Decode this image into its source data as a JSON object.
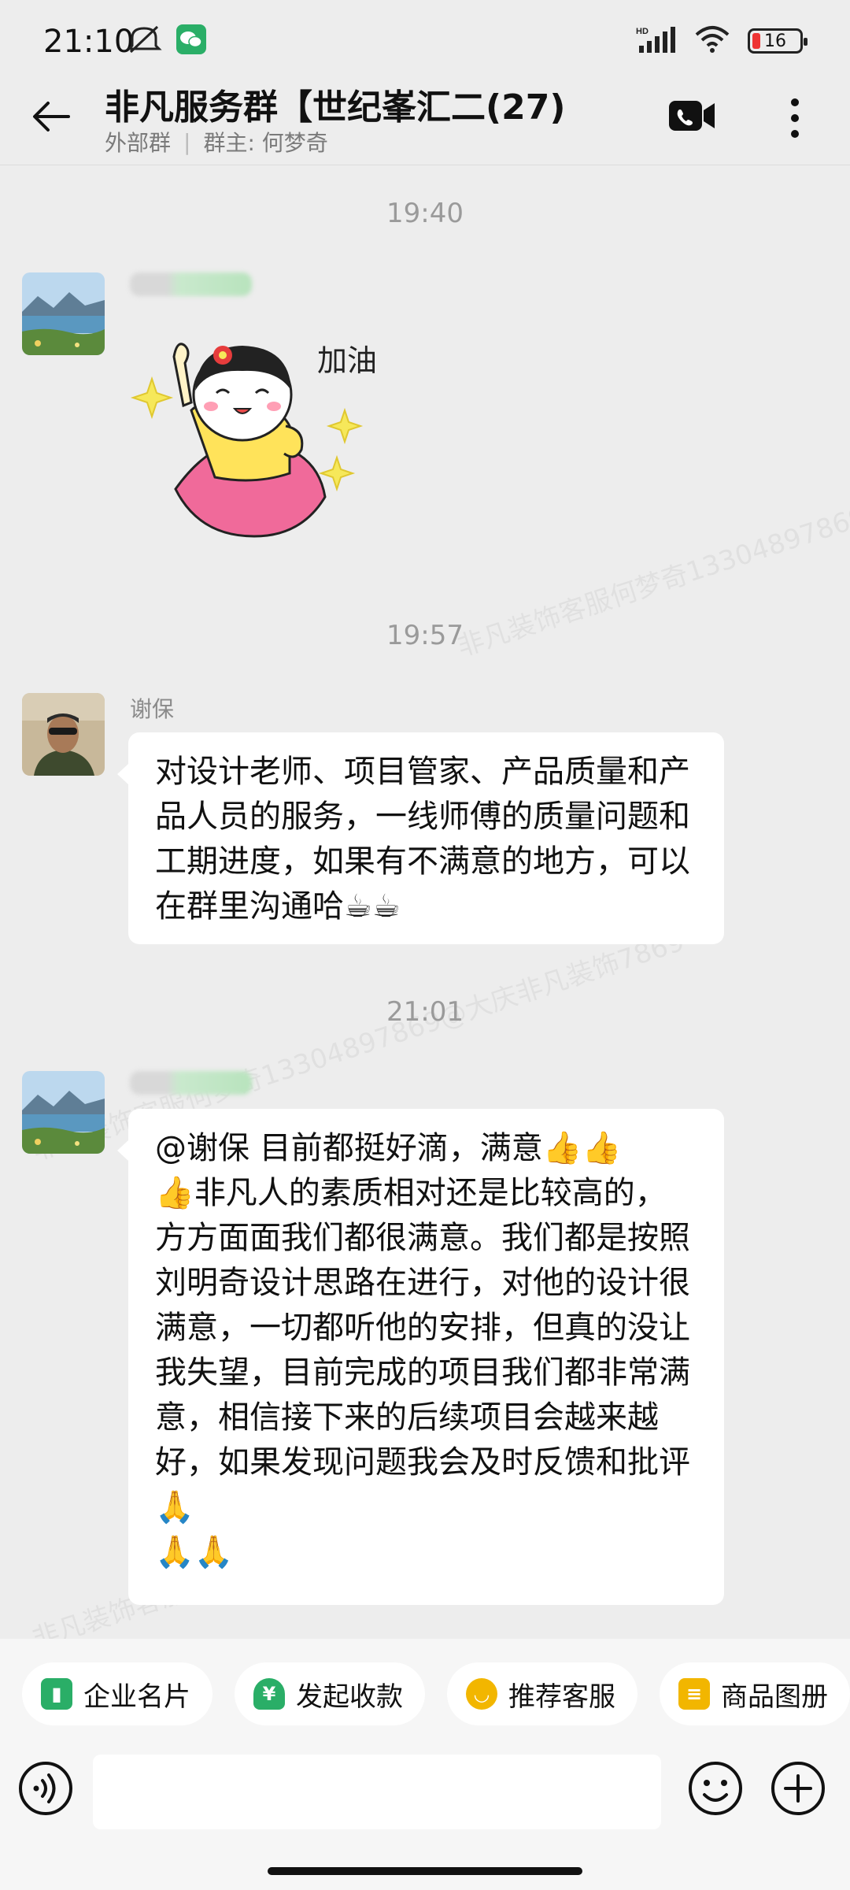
{
  "status_bar": {
    "time": "21:10",
    "battery": "16",
    "network": "HD"
  },
  "header": {
    "title": "非凡服务群【世纪峯汇二(27)",
    "tag": "外部群",
    "owner": "群主: 何梦奇"
  },
  "watermark": "非凡装饰客服何梦奇13304897869@大庆非凡装饰7869",
  "messages": [
    {
      "type": "time",
      "text": "19:40"
    },
    {
      "type": "sticker",
      "sender": "",
      "sticker_text": "加油"
    },
    {
      "type": "time",
      "text": "19:57"
    },
    {
      "type": "text",
      "sender": "谢保",
      "text": "对设计老师、项目管家、产品质量和产品人员的服务，一线师傅的质量问题和工期进度，如果有不满意的地方，可以在群里沟通哈",
      "trailing_emoji": "☕☕"
    },
    {
      "type": "time",
      "text": "21:01"
    },
    {
      "type": "text",
      "sender": "",
      "text_start": "@谢保 目前都挺好滴，满意",
      "emoji_a": "👍👍",
      "emoji_b": "👍",
      "text_mid": "非凡人的素质相对还是比较高的，方方面面我们都很满意。我们都是按照刘明奇设计思路在进行，对他的设计很满意，一切都听他的安排，但真的没让我失望，目前完成的项目我们都非常满意，相信接下来的后续项目会越来越好，如果发现问题我会及时反馈和批评",
      "emoji_c": "🙏",
      "emoji_d": "🙏🙏"
    }
  ],
  "quick_actions": [
    {
      "label": "企业名片",
      "icon": "business-card-icon",
      "color": "#2aae67"
    },
    {
      "label": "发起收款",
      "icon": "payment-icon",
      "color": "#2aae67"
    },
    {
      "label": "推荐客服",
      "icon": "service-icon",
      "color": "#f2b600"
    },
    {
      "label": "商品图册",
      "icon": "catalog-icon",
      "color": "#f2b600"
    }
  ],
  "input": {
    "placeholder": ""
  }
}
